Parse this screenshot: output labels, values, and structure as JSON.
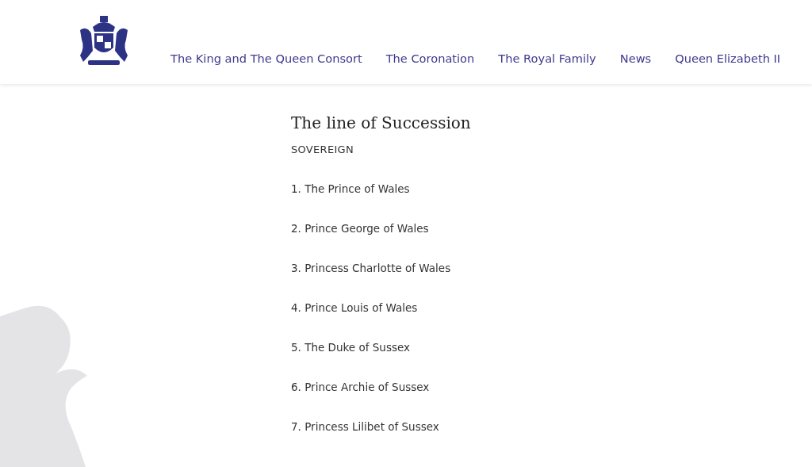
{
  "nav": {
    "items": [
      "The King and The Queen Consort",
      "The Coronation",
      "The Royal Family",
      "News",
      "Queen Elizabeth II"
    ]
  },
  "section": {
    "title": "The line of Succession",
    "subtitle": "SOVEREIGN",
    "items": [
      "1. The Prince of Wales",
      "2. Prince George of Wales",
      "3. Princess Charlotte of Wales",
      "4. Prince Louis of Wales",
      "5. The Duke of Sussex",
      "6. Prince Archie of Sussex",
      "7. Princess Lilibet of Sussex"
    ]
  }
}
